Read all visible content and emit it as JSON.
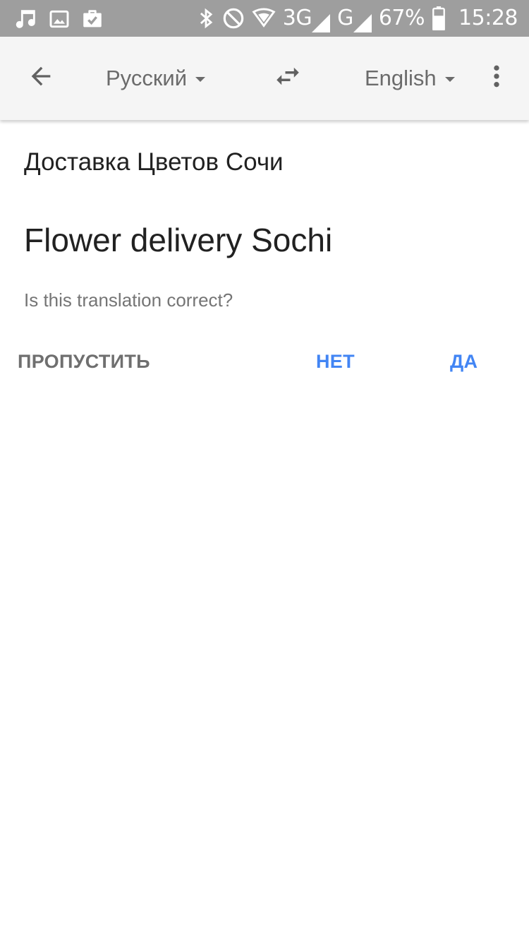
{
  "status_bar": {
    "network": "3G",
    "network2": "G",
    "battery": "67%",
    "time": "15:28",
    "icons": [
      "music-note-icon",
      "image-icon",
      "briefcase-check-icon",
      "bluetooth-icon",
      "do-not-disturb-icon",
      "wifi-icon",
      "signal-icon",
      "signal-icon-2",
      "battery-icon"
    ]
  },
  "toolbar": {
    "back_icon": "arrow-left-icon",
    "source_language": "Русский",
    "swap_icon": "swap-horiz-icon",
    "target_language": "English",
    "menu_icon": "more-vert-icon"
  },
  "content": {
    "source_text": "Доставка Цветов Сочи",
    "translation": "Flower delivery Sochi",
    "question": "Is this translation correct?",
    "actions": {
      "skip": "ПРОПУСТИТЬ",
      "no": "НЕТ",
      "yes": "ДА"
    }
  },
  "colors": {
    "status_bar_bg": "#9e9e9e",
    "toolbar_bg": "#f5f5f5",
    "accent": "#4285f4",
    "primary_text": "#212121",
    "secondary_text": "#757575"
  }
}
